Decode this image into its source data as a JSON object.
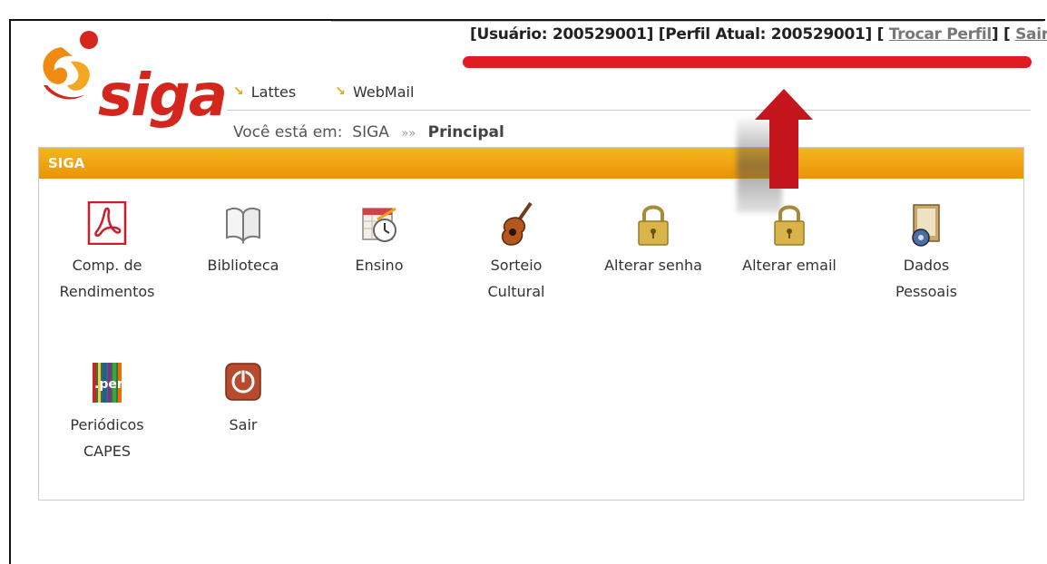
{
  "header": {
    "logo_text": "siga",
    "user_label": "[Usuário: 200529001]",
    "profile_label": "[Perfil Atual: 200529001]",
    "switch_profile_open": "[",
    "switch_profile": "Trocar Perfil",
    "switch_profile_close": "]",
    "logout_open": "[",
    "logout": "Sair",
    "logout_close": "]"
  },
  "links": [
    {
      "label": "Lattes",
      "icon": "arrow-down-right-icon"
    },
    {
      "label": "WebMail",
      "icon": "arrow-down-right-icon"
    }
  ],
  "breadcrumb": {
    "prefix": "Você está em:",
    "root": "SIGA",
    "separator": "»»",
    "current": "Principal"
  },
  "panel": {
    "title": "SIGA",
    "items": [
      {
        "label": "Comp. de\nRendimentos",
        "icon": "pdf-icon"
      },
      {
        "label": "Biblioteca",
        "icon": "book-icon"
      },
      {
        "label": "Ensino",
        "icon": "calendar-clock-icon"
      },
      {
        "label": "Sorteio\nCultural",
        "icon": "guitar-icon"
      },
      {
        "label": "Alterar senha",
        "icon": "padlock-icon"
      },
      {
        "label": "Alterar email",
        "icon": "padlock-icon"
      },
      {
        "label": "Dados\nPessoais",
        "icon": "contact-card-icon"
      },
      {
        "label": "Periódicos\nCAPES",
        "icon": "periodicos-icon"
      },
      {
        "label": "Sair",
        "icon": "power-icon"
      }
    ]
  },
  "colors": {
    "brand_red": "#d4261c",
    "header_orange": "#f0a10f",
    "highlight_red": "#e01b22"
  }
}
